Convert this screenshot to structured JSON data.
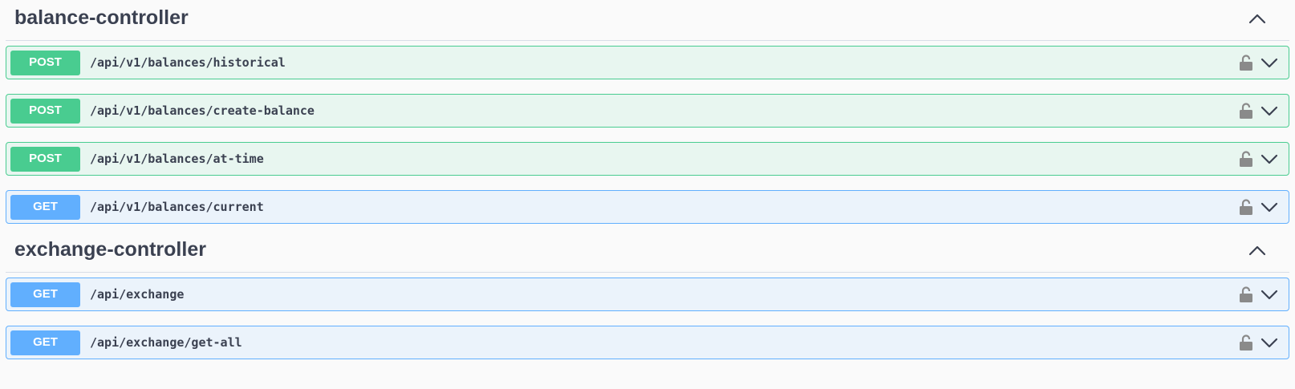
{
  "colors": {
    "post": "#49cc90",
    "get": "#61affe",
    "title": "#3b4151"
  },
  "sections": [
    {
      "title": "balance-controller",
      "toggle_icon": "chevron-up-icon",
      "operations": [
        {
          "method": "POST",
          "path": "/api/v1/balances/historical"
        },
        {
          "method": "POST",
          "path": "/api/v1/balances/create-balance"
        },
        {
          "method": "POST",
          "path": "/api/v1/balances/at-time"
        },
        {
          "method": "GET",
          "path": "/api/v1/balances/current"
        }
      ]
    },
    {
      "title": "exchange-controller",
      "toggle_icon": "chevron-up-icon",
      "operations": [
        {
          "method": "GET",
          "path": "/api/exchange"
        },
        {
          "method": "GET",
          "path": "/api/exchange/get-all"
        }
      ]
    }
  ],
  "operation_icons": [
    "unlock-icon",
    "chevron-down-icon"
  ]
}
